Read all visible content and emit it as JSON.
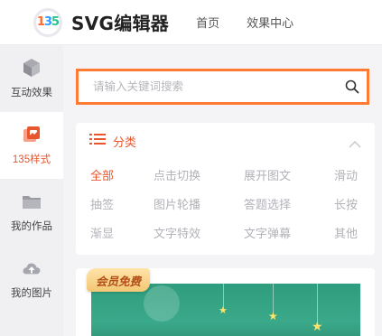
{
  "header": {
    "logo_text": "135",
    "brand": "SVG编辑器",
    "nav": [
      "首页",
      "效果中心"
    ]
  },
  "sidebar": {
    "items": [
      {
        "label": "互动效果",
        "icon": "cube-icon",
        "active": false
      },
      {
        "label": "135样式",
        "icon": "style-cards-icon",
        "active": true
      },
      {
        "label": "我的作品",
        "icon": "folder-icon",
        "active": false
      },
      {
        "label": "我的图片",
        "icon": "cloud-upload-icon",
        "active": false
      }
    ]
  },
  "search": {
    "placeholder": "请输入关键词搜索",
    "value": ""
  },
  "category": {
    "title": "分类",
    "tags": [
      "全部",
      "点击切换",
      "展开图文",
      "滑动",
      "抽签",
      "图片轮播",
      "答题选择",
      "长按",
      "渐显",
      "文字特效",
      "文字弹幕",
      "其他"
    ],
    "active_tag": "全部"
  },
  "promo": {
    "badge": "会员免费"
  },
  "colors": {
    "accent": "#e8562e",
    "search_border": "#ff7a33",
    "promo_green": "#3aa98a"
  }
}
